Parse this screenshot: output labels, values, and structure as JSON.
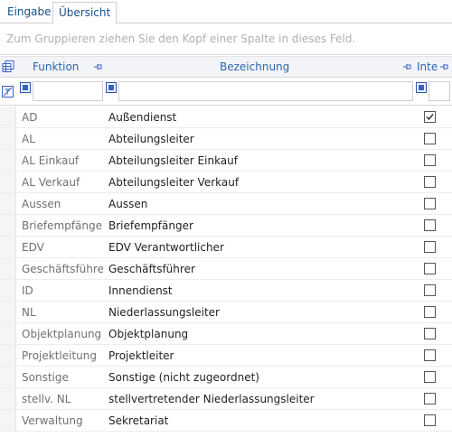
{
  "tabs": [
    {
      "label": "Eingabe",
      "active": false
    },
    {
      "label": "Übersicht",
      "active": true
    }
  ],
  "group_panel": {
    "placeholder": "Zum Gruppieren ziehen Sie den Kopf einer Spalte in dieses Feld."
  },
  "columns": {
    "funktion": "Funktion",
    "bezeichnung": "Bezeichnung",
    "intern": "Inte"
  },
  "icons": {
    "column_chooser": "column-chooser-icon",
    "pin": "pin-icon",
    "clear_filter": "clear-filter-icon",
    "filter_button": "filter-icon"
  },
  "colors": {
    "accent": "#2a68b0",
    "header_bg": "#f2f4f7",
    "muted_text": "#707070"
  },
  "rows": [
    {
      "funktion": "AD",
      "bezeichnung": "Außendienst",
      "checked": true
    },
    {
      "funktion": "AL",
      "bezeichnung": "Abteilungsleiter",
      "checked": false
    },
    {
      "funktion": "AL Einkauf",
      "bezeichnung": "Abteilungsleiter Einkauf",
      "checked": false
    },
    {
      "funktion": "AL Verkauf",
      "bezeichnung": "Abteilungsleiter Verkauf",
      "checked": false
    },
    {
      "funktion": "Aussen",
      "bezeichnung": "Aussen",
      "checked": false
    },
    {
      "funktion": "Briefempfänge",
      "bezeichnung": "Briefempfänger",
      "checked": false
    },
    {
      "funktion": "EDV",
      "bezeichnung": "EDV Verantwortlicher",
      "checked": false
    },
    {
      "funktion": "Geschäftsführe",
      "bezeichnung": "Geschäftsführer",
      "checked": false
    },
    {
      "funktion": "ID",
      "bezeichnung": "Innendienst",
      "checked": false
    },
    {
      "funktion": "NL",
      "bezeichnung": "Niederlassungsleiter",
      "checked": false
    },
    {
      "funktion": "Objektplanung",
      "bezeichnung": "Objektplanung",
      "checked": false
    },
    {
      "funktion": "Projektleitung",
      "bezeichnung": "Projektleiter",
      "checked": false
    },
    {
      "funktion": "Sonstige",
      "bezeichnung": "Sonstige (nicht zugeordnet)",
      "checked": false
    },
    {
      "funktion": "stellv. NL",
      "bezeichnung": "stellvertretender Niederlassungsleiter",
      "checked": false
    },
    {
      "funktion": "Verwaltung",
      "bezeichnung": "Sekretariat",
      "checked": false
    }
  ]
}
